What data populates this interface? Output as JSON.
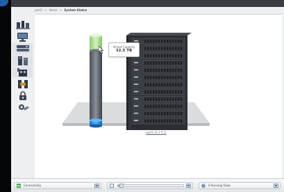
{
  "breadcrumb": {
    "items": [
      "port3",
      "Home"
    ],
    "current": "System Status",
    "separator": ">"
  },
  "sidebar": {
    "items": [
      {
        "icon": "network-nodes-icon",
        "active": false
      },
      {
        "icon": "monitor-icon",
        "active": false
      },
      {
        "icon": "storage-drives-icon",
        "active": true
      },
      {
        "icon": "server-stack-icon",
        "active": true
      },
      {
        "icon": "switch-icon",
        "active": true
      },
      {
        "icon": "connector-icon",
        "active": false
      },
      {
        "icon": "lock-icon",
        "active": false
      },
      {
        "icon": "settings-icon",
        "active": false
      }
    ]
  },
  "capacity": {
    "label": "Virtual Capacity",
    "value": "32.5 TB",
    "used_fraction": 0.82
  },
  "server": {
    "caption": "port3 (5.1.5.1)"
  },
  "statusbar": {
    "connectivity_label": "Connectivity",
    "progress_fraction": 0.05,
    "tasks_label": "0 Running Tasks"
  },
  "colors": {
    "accent_blue": "#2a8ee0",
    "cylinder_top_green": "#b7e39a",
    "server_dark": "#2d3034"
  }
}
